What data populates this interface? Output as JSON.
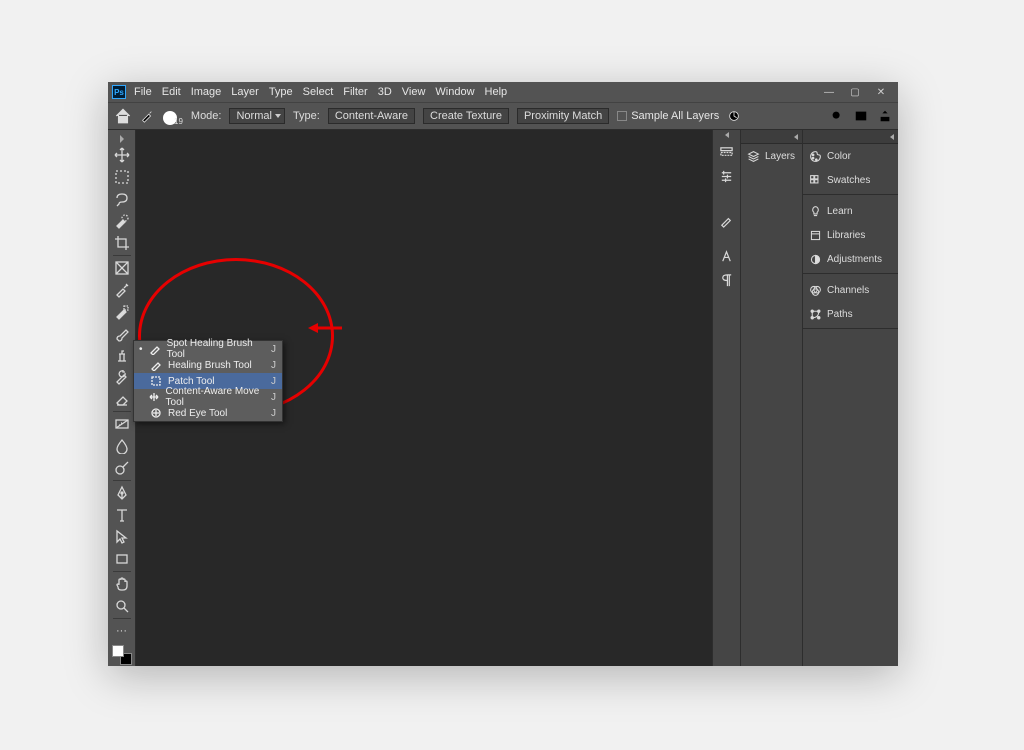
{
  "menubar": [
    "File",
    "Edit",
    "Image",
    "Layer",
    "Type",
    "Select",
    "Filter",
    "3D",
    "View",
    "Window",
    "Help"
  ],
  "options": {
    "brush_size": "19",
    "mode_label": "Mode:",
    "mode_value": "Normal",
    "type_label": "Type:",
    "buttons": [
      "Content-Aware",
      "Create Texture",
      "Proximity Match"
    ],
    "sample_all": "Sample All Layers"
  },
  "flyout": {
    "items": [
      {
        "label": "Spot Healing Brush Tool",
        "key": "J",
        "active": true
      },
      {
        "label": "Healing Brush Tool",
        "key": "J"
      },
      {
        "label": "Patch Tool",
        "key": "J",
        "selected": true
      },
      {
        "label": "Content-Aware Move Tool",
        "key": "J"
      },
      {
        "label": "Red Eye Tool",
        "key": "J"
      }
    ]
  },
  "right_panels": {
    "layers_tab": "Layers",
    "group1": [
      "Color",
      "Swatches"
    ],
    "group2": [
      "Learn",
      "Libraries",
      "Adjustments"
    ],
    "group3": [
      "Channels",
      "Paths"
    ]
  }
}
